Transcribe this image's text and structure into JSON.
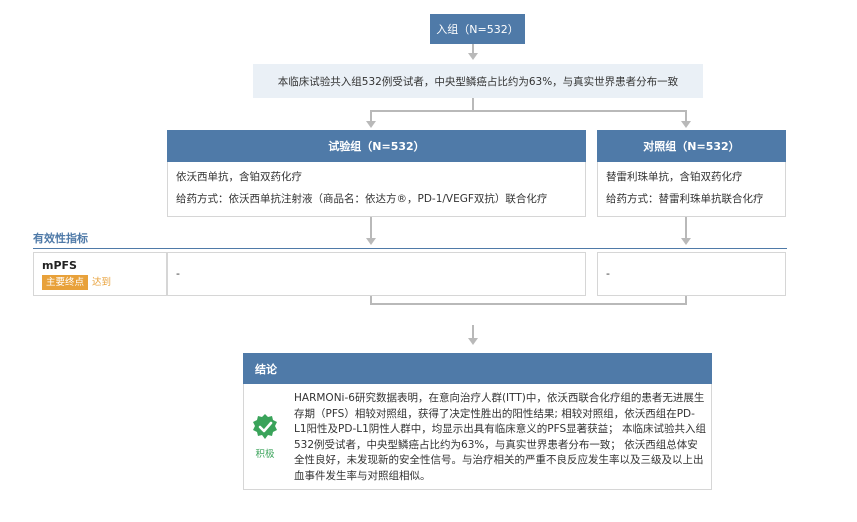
{
  "enroll": {
    "label": "入组（N=532）"
  },
  "summary": {
    "text": "本临床试验共入组532例受试者，中央型鳞癌占比约为63%，与真实世界患者分布一致"
  },
  "arms": [
    {
      "header": "试验组（N=532）",
      "drug": "依沃西单抗，含铂双药化疗",
      "admin": "给药方式：依沃西单抗注射液（商品名：依达方®，PD-1/VEGF双抗）联合化疗"
    },
    {
      "header": "对照组（N=532）",
      "drug": "替雷利珠单抗，含铂双药化疗",
      "admin": "给药方式：替雷利珠单抗联合化疗"
    }
  ],
  "efficacy": {
    "title": "有效性指标",
    "row": {
      "label": "mPFS",
      "tag_primary": "主要终点",
      "tag_met": "达到",
      "arm1_value": "-",
      "arm2_value": "-"
    }
  },
  "conclusion": {
    "title": "结论",
    "badge_label": "积极",
    "badge_icon": "check-shield-icon",
    "text": "HARMONi-6研究数据表明，在意向治疗人群(ITT)中，依沃西联合化疗组的患者无进展生存期（PFS）相较对照组，获得了决定性胜出的阳性结果; 相较对照组，依沃西组在PD-L1阳性及PD-L1阴性人群中，均显示出具有临床意义的PFS显著获益； 本临床试验共入组532例受试者，中央型鳞癌占比约为63%，与真实世界患者分布一致； 依沃西组总体安全性良好，未发现新的安全性信号。与治疗相关的严重不良反应发生率以及三级及以上出血事件发生率与对照组相似。"
  },
  "colors": {
    "accent": "#4f7aa8",
    "tag": "#e8a13a",
    "positive": "#3aa35a",
    "line": "#b9b9b9"
  }
}
